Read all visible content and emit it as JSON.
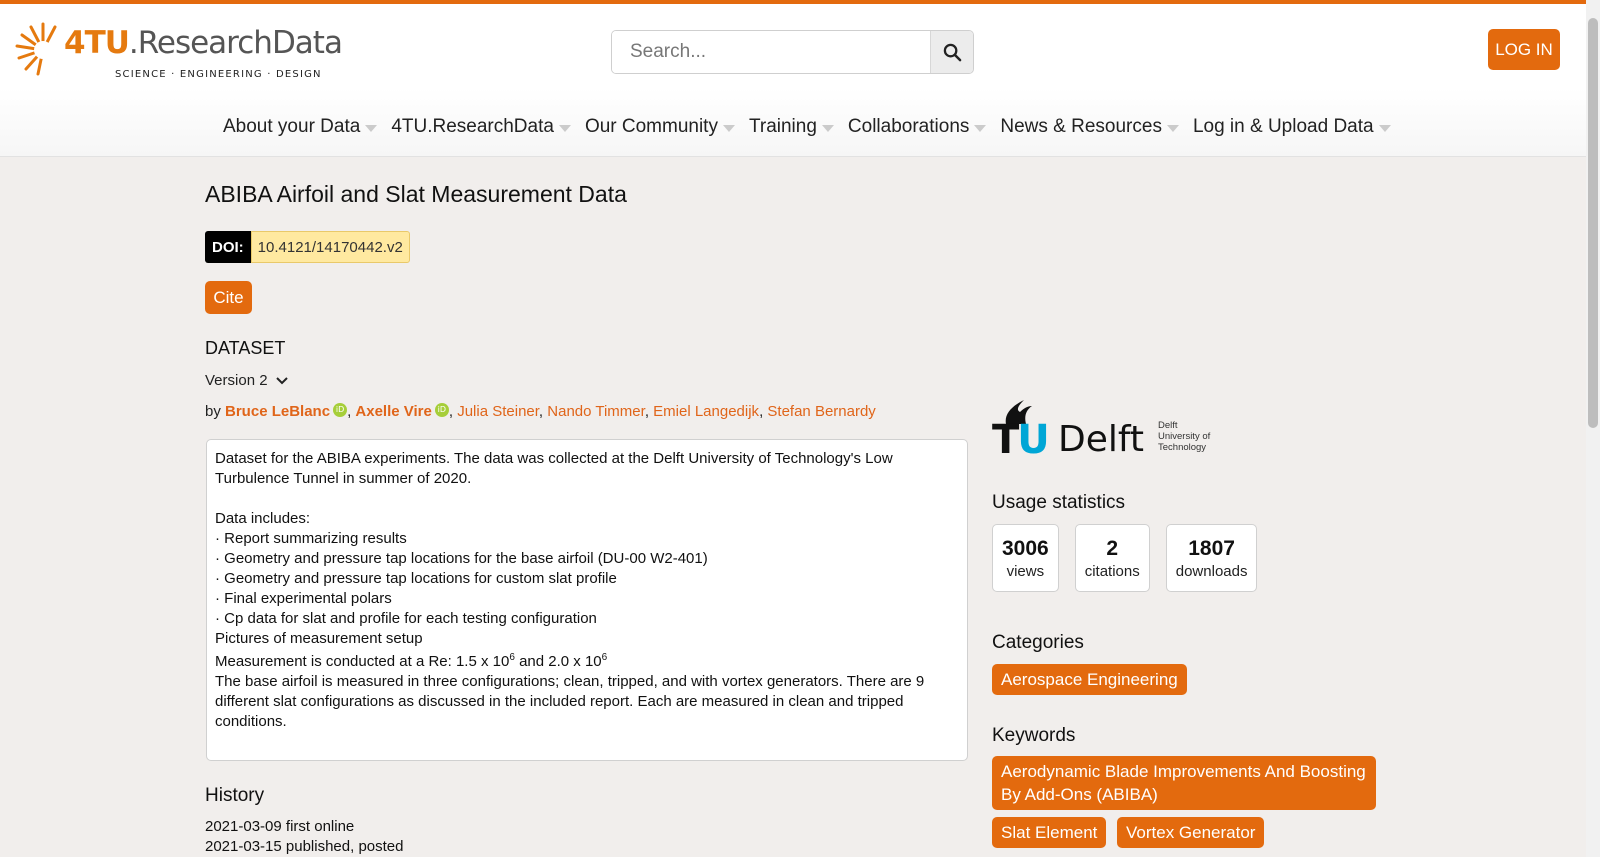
{
  "brand": {
    "name_part1": "4TU",
    "name_part2": ".ResearchData",
    "tagline": "SCIENCE · ENGINEERING · DESIGN",
    "accent_color": "#e36a0e"
  },
  "search": {
    "placeholder": "Search...",
    "icon": "search-icon"
  },
  "header": {
    "login_label": "LOG IN"
  },
  "nav": {
    "items": [
      {
        "label": "About your Data"
      },
      {
        "label": "4TU.ResearchData"
      },
      {
        "label": "Our Community"
      },
      {
        "label": "Training"
      },
      {
        "label": "Collaborations"
      },
      {
        "label": "News & Resources"
      },
      {
        "label": "Log in & Upload Data"
      }
    ]
  },
  "dataset": {
    "title": "ABIBA Airfoil and Slat Measurement Data",
    "doi_label": "DOI:",
    "doi_value": "10.4121/14170442.v2",
    "cite_label": "Cite",
    "section_label": "DATASET",
    "version_label": "Version 2",
    "by_label": "by",
    "authors": [
      {
        "name": "Bruce LeBlanc"
      },
      {
        "name": "Axelle Vire"
      },
      {
        "name": "Julia Steiner"
      },
      {
        "name": "Nando Timmer"
      },
      {
        "name": "Emiel Langedijk"
      },
      {
        "name": "Stefan Bernardy"
      }
    ],
    "description": {
      "intro": "Dataset for the ABIBA experiments. The data was collected at the Delft University of Technology's Low Turbulence Tunnel in summer of 2020.",
      "includes_heading": "Data includes:",
      "bullets": [
        "· Report summarizing results",
        "· Geometry and pressure tap locations for the base airfoil (DU-00 W2-401)",
        "· Geometry and pressure tap locations for custom slat profile",
        "· Final experimental polars",
        "· Cp data for slat and profile for each testing configuration"
      ],
      "pictures": "Pictures of measurement setup",
      "re_prefix": "Measurement is conducted at a Re: 1.5 x 10",
      "re_exp1": "6",
      "re_mid": " and 2.0 x 10",
      "re_exp2": "6",
      "closing": "The base airfoil is measured in three configurations; clean, tripped, and with vortex generators. There are 9 different slat configurations as discussed in the included report. Each are measured in clean and tripped conditions."
    },
    "history_title": "History",
    "history": [
      "2021-03-09 first online",
      "2021-03-15 published, posted"
    ]
  },
  "sidebar": {
    "institution": {
      "tu": "TU",
      "delft": "Delft",
      "line1": "Delft",
      "line2": "University of",
      "line3": "Technology"
    },
    "usage_title": "Usage statistics",
    "stats": [
      {
        "value": "3006",
        "label": "views"
      },
      {
        "value": "2",
        "label": "citations"
      },
      {
        "value": "1807",
        "label": "downloads"
      }
    ],
    "categories_title": "Categories",
    "categories": [
      "Aerospace Engineering"
    ],
    "keywords_title": "Keywords",
    "keywords": [
      "Aerodynamic Blade Improvements And Boosting By Add-Ons (ABIBA)",
      "Slat Element",
      "Vortex Generator"
    ]
  }
}
